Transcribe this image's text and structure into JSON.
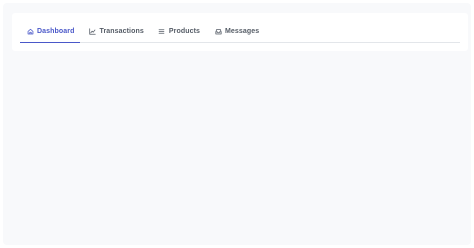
{
  "tabs": [
    {
      "label": "Dashboard",
      "icon": "home-icon",
      "active": true
    },
    {
      "label": "Transactions",
      "icon": "chart-line-icon",
      "active": false
    },
    {
      "label": "Products",
      "icon": "list-icon",
      "active": false
    },
    {
      "label": "Messages",
      "icon": "inbox-icon",
      "active": false
    }
  ],
  "colors": {
    "accent": "#4a58c9",
    "tab_text": "#555c66",
    "page_background": "#f8f9fb",
    "card_background": "#ffffff"
  }
}
